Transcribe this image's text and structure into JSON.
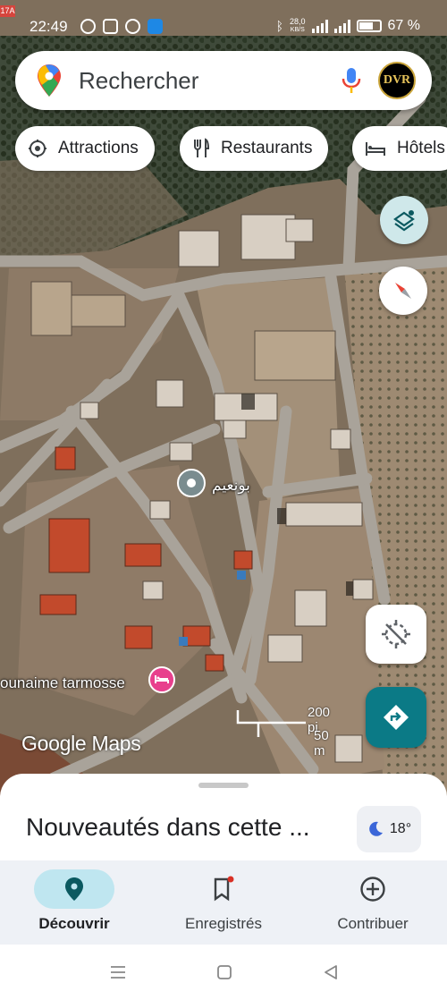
{
  "status_bar": {
    "time": "22:49",
    "net_speed_value": "28,0",
    "net_speed_unit": "KB/S",
    "battery": "67 %",
    "corner_tag": "17A"
  },
  "search": {
    "placeholder": "Rechercher",
    "avatar_text": "DVR"
  },
  "chips": [
    {
      "label": "Attractions",
      "icon": "attraction-icon"
    },
    {
      "label": "Restaurants",
      "icon": "restaurant-icon"
    },
    {
      "label": "Hôtels",
      "icon": "hotel-icon"
    }
  ],
  "map": {
    "place_arabic": "بونعيم",
    "hotel_label": "ounaime tarmosse",
    "scale_imperial": "200 pi",
    "scale_metric": "50 m",
    "logo": "Google Maps"
  },
  "sheet": {
    "title": "Nouveautés dans cette ...",
    "temperature": "18°",
    "weather_icon": "moon-icon"
  },
  "nav": [
    {
      "label": "Découvrir",
      "icon": "explore-pin-icon",
      "active": true
    },
    {
      "label": "Enregistrés",
      "icon": "bookmark-icon",
      "active": false
    },
    {
      "label": "Contribuer",
      "icon": "add-circle-icon",
      "active": false
    }
  ],
  "colors": {
    "accent": "#0b7a86",
    "nav_active_bg": "#bfe6f0",
    "hotel_pin": "#e8408d"
  }
}
